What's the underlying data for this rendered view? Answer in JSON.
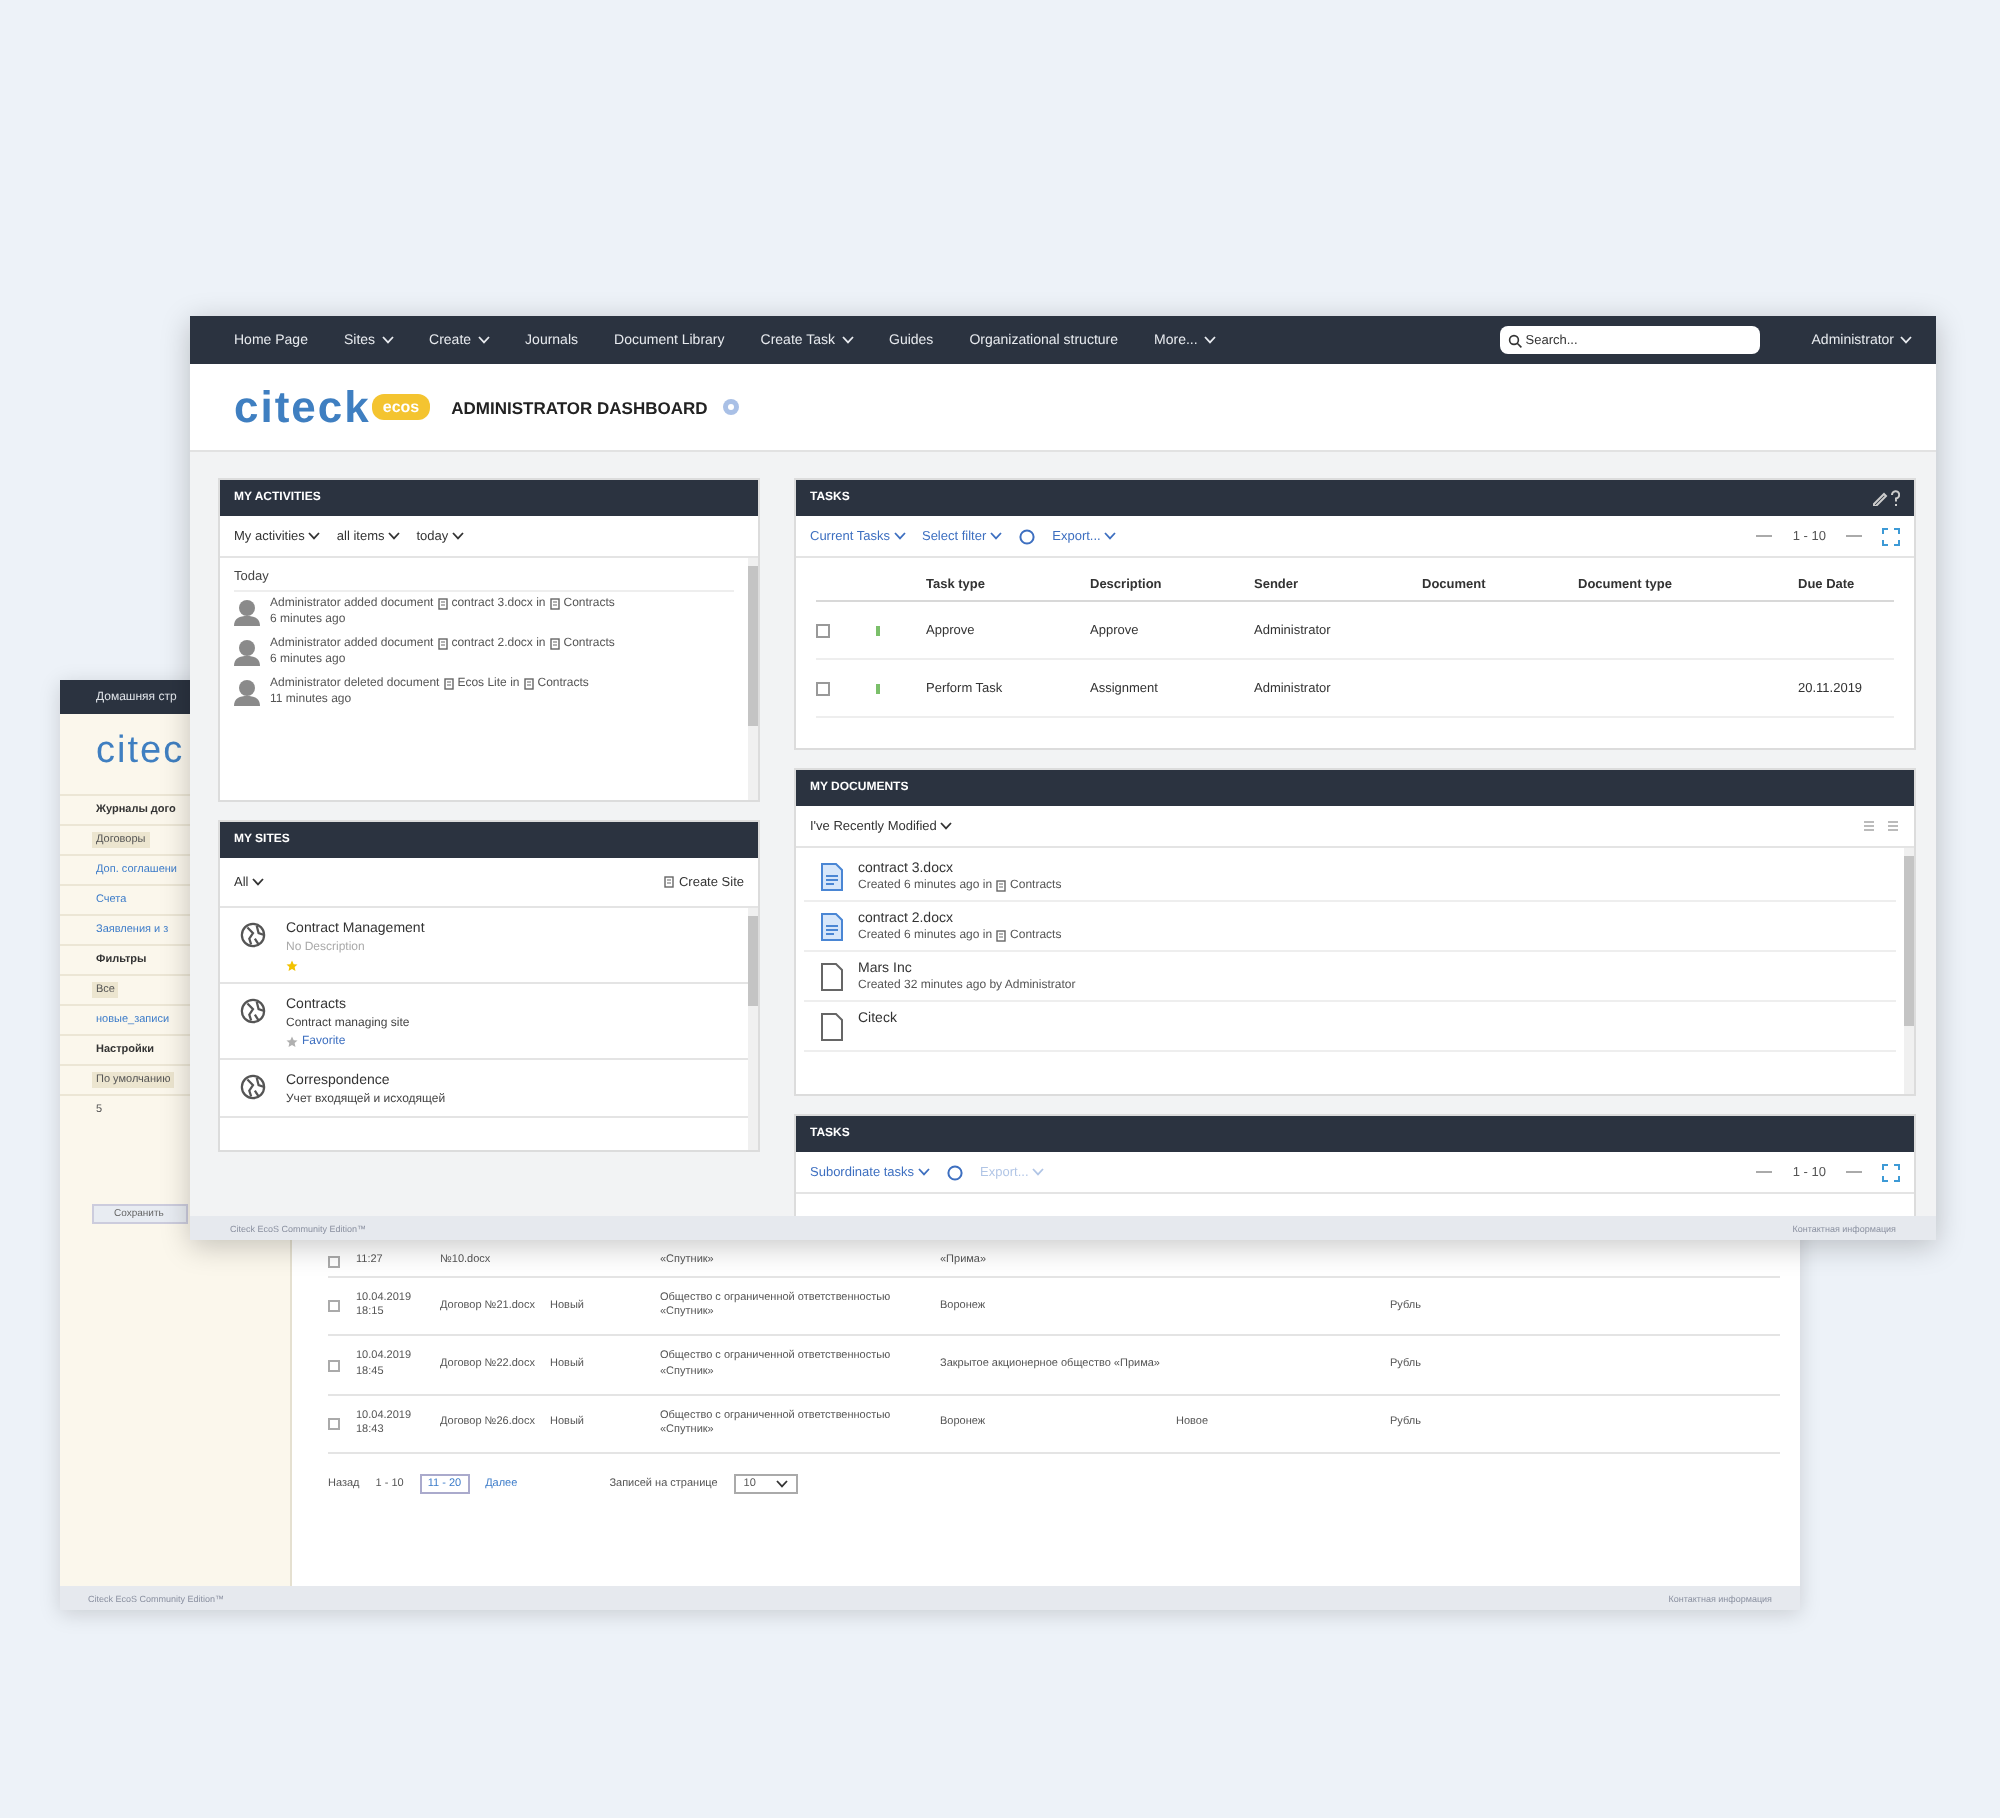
{
  "back_window": {
    "nav_item": "Домашняя стр",
    "logo": "citec",
    "sidebar": [
      {
        "kind": "heading",
        "label": "Журналы дого"
      },
      {
        "kind": "item",
        "label": "Договоры",
        "selected": true
      },
      {
        "kind": "link",
        "label": "Доп. соглашени",
        "selected": false
      },
      {
        "kind": "link",
        "label": "Счета",
        "selected": false
      },
      {
        "kind": "link",
        "label": "Заявления и з",
        "selected": false
      },
      {
        "kind": "heading",
        "label": "Фильтры"
      },
      {
        "kind": "item",
        "label": "Все",
        "selected": true
      },
      {
        "kind": "link",
        "label": "новые_записи",
        "selected": false
      },
      {
        "kind": "heading",
        "label": "Настройки"
      },
      {
        "kind": "item",
        "label": "По умолчанию",
        "selected": true
      },
      {
        "kind": "item",
        "label": "5",
        "selected": false
      }
    ],
    "sidebar_button": "Сохранить",
    "rows": [
      {
        "checked": false,
        "cells": [
          "11:27",
          "№10.docx",
          "",
          "«Спутник»",
          "«Прима»",
          "",
          ""
        ]
      },
      {
        "checked": false,
        "cells": [
          "10.04.2019 18:15",
          "Договор №21.docx",
          "Новый",
          "Общество с ограниченной ответственностью «Спутник»",
          "Воронеж",
          "",
          "Рубль"
        ]
      },
      {
        "checked": false,
        "cells": [
          "10.04.2019 18:45",
          "Договор №22.docx",
          "Новый",
          "Общество с ограниченной ответственностью «Спутник»",
          "Закрытое акционерное общество «Прима»",
          "",
          "Рубль"
        ]
      },
      {
        "checked": false,
        "cells": [
          "10.04.2019 18:43",
          "Договор №26.docx",
          "Новый",
          "Общество с ограниченной ответственностью «Спутник»",
          "Воронеж",
          "Новое",
          "Рубль"
        ]
      }
    ],
    "pagination": {
      "prev": "Назад",
      "current": "1 - 10",
      "next_range": "11 - 20",
      "next": "Далее",
      "page_size_label": "Записей на странице",
      "page_size": "10"
    },
    "footer": {
      "left": "Citeck EcoS Community Edition™",
      "right": "Контактная информация"
    }
  },
  "window": {
    "nav": [
      {
        "label": "Home Page",
        "dropdown": false
      },
      {
        "label": "Sites",
        "dropdown": true
      },
      {
        "label": "Create",
        "dropdown": true
      },
      {
        "label": "Journals",
        "dropdown": false
      },
      {
        "label": "Document Library",
        "dropdown": false
      },
      {
        "label": "Create Task",
        "dropdown": true
      },
      {
        "label": "Guides",
        "dropdown": false
      },
      {
        "label": "Organizational structure",
        "dropdown": false
      },
      {
        "label": "More...",
        "dropdown": true
      }
    ],
    "search": {
      "placeholder": "Search..."
    },
    "user": "Administrator",
    "logo": {
      "text": "citeck",
      "badge": "ecos"
    },
    "title": "ADMINISTRATOR DASHBOARD",
    "activities": {
      "title": "MY ACTIVITIES",
      "filters": [
        "My activities",
        "all items",
        "today"
      ],
      "group": "Today",
      "items": [
        {
          "actor": "Administrator added document",
          "target": "contract 3.docx",
          "preposition": "in",
          "place": "Contracts",
          "time": "6 minutes ago"
        },
        {
          "actor": "Administrator added document",
          "target": "contract 2.docx",
          "preposition": "in",
          "place": "Contracts",
          "time": "6 minutes ago"
        },
        {
          "actor": "Administrator deleted document",
          "target": "Ecos Lite",
          "preposition": "in",
          "place": "Contracts",
          "time": "11 minutes ago"
        }
      ]
    },
    "sites": {
      "title": "MY SITES",
      "filter": "All",
      "create": "Create Site",
      "items": [
        {
          "name": "Contract Management",
          "description": "No Description",
          "favorite": true
        },
        {
          "name": "Contracts",
          "description": "Contract managing site",
          "favorite": false,
          "favorite_label": "Favorite"
        },
        {
          "name": "Correspondence",
          "description": "Учет входящей и исходящей",
          "favorite": false
        }
      ]
    },
    "tasks": {
      "title": "TASKS",
      "toolbar": [
        "Current Tasks",
        "Select filter"
      ],
      "export": "Export...",
      "range": "1 - 10",
      "columns": [
        "Task type",
        "Description",
        "Sender",
        "Document",
        "Document type",
        "Due Date"
      ],
      "rows": [
        {
          "checked": false,
          "cells": [
            "Approve",
            "Approve",
            "Administrator",
            "",
            "",
            ""
          ]
        },
        {
          "checked": false,
          "cells": [
            "Perform Task",
            "Assignment",
            "Administrator",
            "",
            "",
            "20.11.2019"
          ]
        }
      ]
    },
    "documents": {
      "title": "MY DOCUMENTS",
      "filter": "I've Recently Modified",
      "items": [
        {
          "kind": "docx",
          "name": "contract 3.docx",
          "info": "Created 6 minutes ago in",
          "place": "Contracts"
        },
        {
          "kind": "docx",
          "name": "contract 2.docx",
          "info": "Created 6 minutes ago in",
          "place": "Contracts"
        },
        {
          "kind": "file",
          "name": "Mars Inc",
          "info": "Created 32 minutes ago by Administrator"
        },
        {
          "kind": "file",
          "name": "Citeck"
        }
      ]
    },
    "subtasks": {
      "title": "TASKS",
      "filter": "Subordinate tasks",
      "export": "Export...",
      "export_disabled": true,
      "range": "1 - 10"
    },
    "footer": {
      "left": "Citeck EcoS Community Edition™",
      "right": "Контактная информация"
    }
  }
}
